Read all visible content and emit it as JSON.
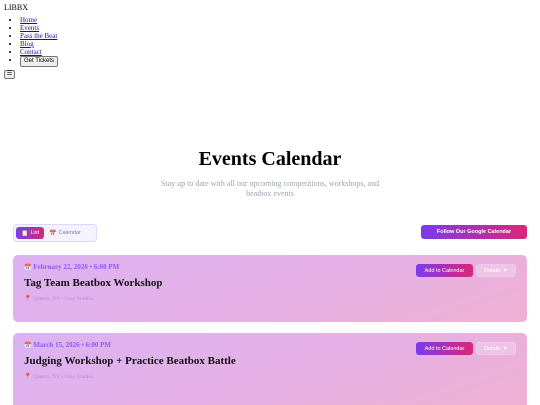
{
  "brand": "LIBBX",
  "nav": {
    "items": [
      "Home",
      "Events",
      "Pass the Beat",
      "Blog",
      "Contact"
    ],
    "tickets_label": "Get Tickets",
    "menu_icon": "☰"
  },
  "hero": {
    "title": "Events Calendar",
    "subtitle": "Stay up to date with all our upcoming competitions, workshops, and beatbox events"
  },
  "view_toggle": {
    "list_label": "List",
    "calendar_label": "Calendar"
  },
  "google_button": "Follow Our Google Calendar",
  "events": [
    {
      "date": "February 22, 2026 • 6:00 PM",
      "title": "Tag Team Beatbox Workshop",
      "location": "Queens, NY • Grey Studios",
      "add_label": "Add to Calendar",
      "details_label": "Details ▼"
    },
    {
      "date": "March 15, 2026 • 6:00 PM",
      "title": "Judging Workshop + Practice Beatbox Battle",
      "location": "Queens, NY • Grey Studios",
      "add_label": "Add to Calendar",
      "details_label": "Details ▼"
    }
  ],
  "colors": {
    "accent_start": "#7c3aed",
    "accent_end": "#db2777",
    "card_bg": "#e3b0e6"
  }
}
